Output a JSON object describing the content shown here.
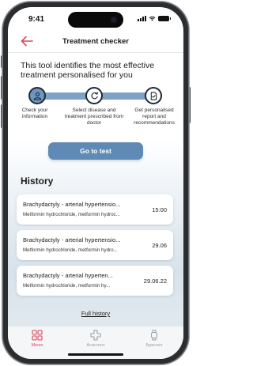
{
  "status_bar": {
    "time": "9:41"
  },
  "header": {
    "title": "Treatment checker"
  },
  "intro": {
    "text": "This tool identifies the most effective treatment personalised for you"
  },
  "steps": [
    {
      "label": "Check your information",
      "icon": "user-icon",
      "active": true
    },
    {
      "label": "Select disease and treatment prescribed from doctor",
      "icon": "refresh-icon",
      "active": false
    },
    {
      "label": "Get personalised report and recommendations",
      "icon": "report-icon",
      "active": false
    }
  ],
  "cta": {
    "label": "Go to test"
  },
  "history": {
    "title": "History",
    "items": [
      {
        "title": "Brachydactyly - arterial hypertensio...",
        "subtitle": "Metformin hydrochloride, metformin hydroc...",
        "date": "15:00"
      },
      {
        "title": "Brachydactyly - arterial hypertensio...",
        "subtitle": "Metformin hydrochloride, metformin hydro...",
        "date": "29.06"
      },
      {
        "title": "Brachydactyly - arterial hyperten...",
        "subtitle": "Metformin hydrochloride, metformin hy...",
        "date": "29.06.22"
      }
    ],
    "full_link": "Full history"
  },
  "tabs": [
    {
      "label": "Меню",
      "icon": "grid-icon",
      "active": true
    },
    {
      "label": "Асистент",
      "icon": "plus-cross-icon",
      "active": false
    },
    {
      "label": "Браслет",
      "icon": "watch-icon",
      "active": false
    }
  ],
  "colors": {
    "accent": "#5f8ab5",
    "back_arrow": "#e0465a",
    "active_tab": "#e0465a"
  }
}
